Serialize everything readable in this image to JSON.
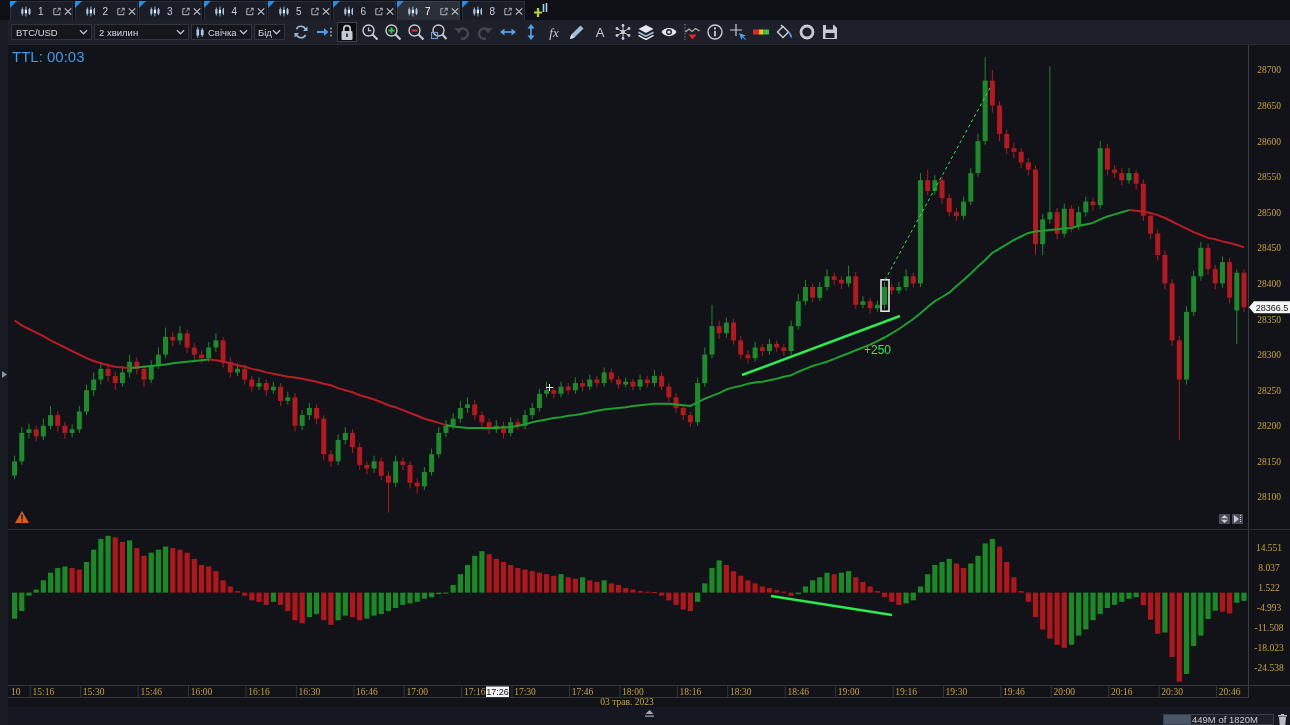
{
  "tabs": [
    {
      "label": "1",
      "selected": false
    },
    {
      "label": "2",
      "selected": false
    },
    {
      "label": "3",
      "selected": false
    },
    {
      "label": "4",
      "selected": false
    },
    {
      "label": "5",
      "selected": false
    },
    {
      "label": "6",
      "selected": false
    },
    {
      "label": "7",
      "selected": true
    },
    {
      "label": "8",
      "selected": false
    }
  ],
  "toolbar": {
    "selects": [
      {
        "kind": "symbol",
        "value": "BTC/USD"
      },
      {
        "kind": "timeframe",
        "value": "2 хвилин"
      },
      {
        "kind": "chart_type",
        "value": "Свічка"
      },
      {
        "kind": "price_side",
        "value": "Бід"
      }
    ],
    "tools": [
      {
        "kind": "refresh",
        "selected": false,
        "disabled": false
      },
      {
        "kind": "scroll_end",
        "selected": false,
        "disabled": false
      },
      {
        "kind": "lock",
        "selected": true,
        "disabled": false
      },
      {
        "kind": "zoom_time",
        "selected": false,
        "disabled": false
      },
      {
        "kind": "zoom_in",
        "selected": false,
        "disabled": false
      },
      {
        "kind": "zoom_out",
        "selected": false,
        "disabled": false
      },
      {
        "kind": "zoom_fit",
        "selected": false,
        "disabled": false
      },
      {
        "kind": "undo",
        "selected": false,
        "disabled": true
      },
      {
        "kind": "redo",
        "selected": false,
        "disabled": true
      },
      {
        "kind": "pan_horizontal",
        "selected": false,
        "disabled": false
      },
      {
        "kind": "pan_vertical",
        "selected": false,
        "disabled": false
      },
      {
        "kind": "function",
        "label": "fx",
        "selected": false,
        "disabled": false
      },
      {
        "kind": "pencil",
        "selected": false,
        "disabled": false
      },
      {
        "kind": "text",
        "label": "A",
        "selected": false,
        "disabled": false
      },
      {
        "kind": "nodes",
        "selected": false,
        "disabled": false
      },
      {
        "kind": "layers",
        "selected": false,
        "disabled": false
      },
      {
        "kind": "eye",
        "selected": false,
        "disabled": false
      },
      {
        "kind": "indicator",
        "selected": false,
        "disabled": false
      },
      {
        "kind": "info",
        "selected": false,
        "disabled": false
      },
      {
        "kind": "crosshair",
        "selected": false,
        "disabled": false
      },
      {
        "kind": "color_bar",
        "selected": false,
        "disabled": false
      },
      {
        "kind": "bucket",
        "selected": false,
        "disabled": false
      },
      {
        "kind": "ring",
        "selected": false,
        "disabled": false
      },
      {
        "kind": "save",
        "selected": false,
        "disabled": false
      }
    ]
  },
  "price_pane": {
    "timer": "TTL: 00:03",
    "last_price_label": "28366.5"
  },
  "chart_data": [
    {
      "type": "candlestick",
      "tick_labels": "y",
      "ylim": [
        28055,
        28735
      ],
      "yticks": [
        28100,
        28150,
        28200,
        28250,
        28300,
        28350,
        28400,
        28450,
        28500,
        28550,
        28600,
        28650,
        28700
      ],
      "annotations": [
        "+250"
      ],
      "series": [
        {
          "type": "candlestick",
          "ohlc": [
            [
              28130,
              28158,
              28125,
              28150
            ],
            [
              28150,
              28198,
              28145,
              28190
            ],
            [
              28190,
              28203,
              28182,
              28195
            ],
            [
              28195,
              28200,
              28178,
              28185
            ],
            [
              28185,
              28210,
              28180,
              28200
            ],
            [
              28200,
              28228,
              28195,
              28215
            ],
            [
              28215,
              28220,
              28192,
              28200
            ],
            [
              28200,
              28205,
              28182,
              28190
            ],
            [
              28190,
              28202,
              28184,
              28195
            ],
            [
              28195,
              28228,
              28190,
              28220
            ],
            [
              28220,
              28258,
              28215,
              28250
            ],
            [
              28250,
              28275,
              28242,
              28265
            ],
            [
              28265,
              28290,
              28258,
              28280
            ],
            [
              28280,
              28288,
              28262,
              28270
            ],
            [
              28270,
              28276,
              28250,
              28260
            ],
            [
              28260,
              28284,
              28255,
              28275
            ],
            [
              28275,
              28300,
              28268,
              28290
            ],
            [
              28290,
              28296,
              28272,
              28280
            ],
            [
              28280,
              28285,
              28255,
              28265
            ],
            [
              28265,
              28292,
              28260,
              28285
            ],
            [
              28285,
              28310,
              28280,
              28300
            ],
            [
              28300,
              28338,
              28295,
              28325
            ],
            [
              28325,
              28332,
              28312,
              28320
            ],
            [
              28320,
              28340,
              28314,
              28330
            ],
            [
              28330,
              28335,
              28302,
              28310
            ],
            [
              28310,
              28316,
              28292,
              28300
            ],
            [
              28300,
              28306,
              28288,
              28295
            ],
            [
              28295,
              28318,
              28290,
              28310
            ],
            [
              28310,
              28330,
              28304,
              28320
            ],
            [
              28320,
              28325,
              28282,
              28290
            ],
            [
              28290,
              28296,
              28268,
              28275
            ],
            [
              28275,
              28288,
              28270,
              28280
            ],
            [
              28280,
              28286,
              28258,
              28265
            ],
            [
              28265,
              28270,
              28248,
              28255
            ],
            [
              28255,
              28268,
              28250,
              28260
            ],
            [
              28260,
              28265,
              28242,
              28250
            ],
            [
              28250,
              28262,
              28245,
              28255
            ],
            [
              28255,
              28260,
              28228,
              28235
            ],
            [
              28235,
              28248,
              28230,
              28240
            ],
            [
              28240,
              28246,
              28192,
              28200
            ],
            [
              28200,
              28222,
              28194,
              28215
            ],
            [
              28215,
              28232,
              28208,
              28225
            ],
            [
              28225,
              28230,
              28202,
              28210
            ],
            [
              28210,
              28215,
              28152,
              28160
            ],
            [
              28160,
              28166,
              28142,
              28150
            ],
            [
              28150,
              28188,
              28145,
              28180
            ],
            [
              28180,
              28198,
              28174,
              28190
            ],
            [
              28190,
              28195,
              28162,
              28170
            ],
            [
              28170,
              28176,
              28138,
              28145
            ],
            [
              28145,
              28150,
              28132,
              28140
            ],
            [
              28140,
              28158,
              28134,
              28150
            ],
            [
              28150,
              28156,
              28124,
              28130
            ],
            [
              28130,
              28136,
              28078,
              28120
            ],
            [
              28120,
              28158,
              28114,
              28150
            ],
            [
              28150,
              28156,
              28138,
              28145
            ],
            [
              28145,
              28150,
              28112,
              28120
            ],
            [
              28120,
              28126,
              28105,
              28115
            ],
            [
              28115,
              28142,
              28110,
              28135
            ],
            [
              28135,
              28168,
              28130,
              28160
            ],
            [
              28160,
              28198,
              28155,
              28190
            ],
            [
              28190,
              28208,
              28184,
              28200
            ],
            [
              28200,
              28218,
              28195,
              28210
            ],
            [
              28210,
              28235,
              28204,
              28225
            ],
            [
              28225,
              28240,
              28218,
              28230
            ],
            [
              28230,
              28236,
              28208,
              28215
            ],
            [
              28215,
              28220,
              28198,
              28205
            ],
            [
              28205,
              28210,
              28188,
              28195
            ],
            [
              28195,
              28208,
              28190,
              28200
            ],
            [
              28200,
              28206,
              28182,
              28190
            ],
            [
              28190,
              28212,
              28185,
              28205
            ],
            [
              28205,
              28210,
              28194,
              28200
            ],
            [
              28200,
              28222,
              28195,
              28215
            ],
            [
              28215,
              28232,
              28210,
              28225
            ],
            [
              28225,
              28252,
              28220,
              28245
            ],
            [
              28245,
              28262,
              28240,
              28250
            ],
            [
              28250,
              28255,
              28238,
              28245
            ],
            [
              28245,
              28262,
              28240,
              28255
            ],
            [
              28255,
              28260,
              28244,
              28250
            ],
            [
              28250,
              28268,
              28245,
              28260
            ],
            [
              28260,
              28265,
              28248,
              28255
            ],
            [
              28255,
              28272,
              28250,
              28265
            ],
            [
              28265,
              28270,
              28254,
              28260
            ],
            [
              28260,
              28282,
              28255,
              28275
            ],
            [
              28275,
              28280,
              28260,
              28265
            ],
            [
              28265,
              28270,
              28252,
              28258
            ],
            [
              28258,
              28268,
              28254,
              28262
            ],
            [
              28262,
              28266,
              28250,
              28255
            ],
            [
              28255,
              28272,
              28250,
              28265
            ],
            [
              28265,
              28270,
              28254,
              28260
            ],
            [
              28260,
              28278,
              28255,
              28270
            ],
            [
              28270,
              28275,
              28250,
              28255
            ],
            [
              28255,
              28260,
              28234,
              28240
            ],
            [
              28240,
              28246,
              28218,
              28225
            ],
            [
              28225,
              28230,
              28208,
              28215
            ],
            [
              28215,
              28220,
              28198,
              28205
            ],
            [
              28205,
              28268,
              28200,
              28260
            ],
            [
              28260,
              28310,
              28255,
              28300
            ],
            [
              28300,
              28370,
              28295,
              28340
            ],
            [
              28340,
              28348,
              28322,
              28330
            ],
            [
              28330,
              28352,
              28324,
              28345
            ],
            [
              28345,
              28350,
              28314,
              28320
            ],
            [
              28320,
              28326,
              28294,
              28300
            ],
            [
              28300,
              28306,
              28288,
              28295
            ],
            [
              28295,
              28318,
              28290,
              28310
            ],
            [
              28310,
              28315,
              28298,
              28305
            ],
            [
              28305,
              28322,
              28300,
              28315
            ],
            [
              28315,
              28320,
              28304,
              28310
            ],
            [
              28310,
              28315,
              28298,
              28305
            ],
            [
              28305,
              28348,
              28300,
              28340
            ],
            [
              28340,
              28385,
              28335,
              28375
            ],
            [
              28375,
              28405,
              28370,
              28395
            ],
            [
              28395,
              28400,
              28374,
              28380
            ],
            [
              28380,
              28402,
              28375,
              28395
            ],
            [
              28395,
              28420,
              28390,
              28410
            ],
            [
              28410,
              28415,
              28398,
              28405
            ],
            [
              28405,
              28410,
              28392,
              28400
            ],
            [
              28400,
              28425,
              28395,
              28410
            ],
            [
              28410,
              28416,
              28364,
              28370
            ],
            [
              28370,
              28382,
              28365,
              28375
            ],
            [
              28375,
              28380,
              28358,
              28365
            ],
            [
              28365,
              28376,
              28360,
              28370
            ],
            [
              28370,
              28402,
              28364,
              28395
            ],
            [
              28395,
              28400,
              28384,
              28390
            ],
            [
              28390,
              28402,
              28385,
              28395
            ],
            [
              28395,
              28420,
              28390,
              28410
            ],
            [
              28410,
              28415,
              28394,
              28400
            ],
            [
              28400,
              28555,
              28395,
              28545
            ],
            [
              28545,
              28560,
              28524,
              28530
            ],
            [
              28530,
              28552,
              28525,
              28545
            ],
            [
              28545,
              28550,
              28512,
              28520
            ],
            [
              28520,
              28526,
              28494,
              28500
            ],
            [
              28500,
              28506,
              28488,
              28495
            ],
            [
              28495,
              28522,
              28490,
              28515
            ],
            [
              28515,
              28562,
              28510,
              28555
            ],
            [
              28555,
              28610,
              28550,
              28600
            ],
            [
              28600,
              28718,
              28595,
              28685
            ],
            [
              28685,
              28700,
              28640,
              28650
            ],
            [
              28650,
              28656,
              28600,
              28610
            ],
            [
              28610,
              28616,
              28582,
              28590
            ],
            [
              28590,
              28598,
              28576,
              28585
            ],
            [
              28585,
              28590,
              28562,
              28570
            ],
            [
              28570,
              28576,
              28552,
              28560
            ],
            [
              28560,
              28566,
              28440,
              28455
            ],
            [
              28455,
              28498,
              28440,
              28490
            ],
            [
              28490,
              28705,
              28484,
              28500
            ],
            [
              28500,
              28506,
              28462,
              28470
            ],
            [
              28470,
              28512,
              28465,
              28505
            ],
            [
              28505,
              28510,
              28472,
              28480
            ],
            [
              28480,
              28508,
              28475,
              28500
            ],
            [
              28500,
              28522,
              28494,
              28515
            ],
            [
              28515,
              28520,
              28502,
              28510
            ],
            [
              28510,
              28600,
              28505,
              28590
            ],
            [
              28590,
              28596,
              28552,
              28560
            ],
            [
              28560,
              28566,
              28548,
              28555
            ],
            [
              28555,
              28562,
              28538,
              28545
            ],
            [
              28545,
              28562,
              28540,
              28555
            ],
            [
              28555,
              28560,
              28532,
              28540
            ],
            [
              28540,
              28546,
              28488,
              28495
            ],
            [
              28495,
              28500,
              28462,
              28470
            ],
            [
              28470,
              28476,
              28432,
              28440
            ],
            [
              28440,
              28446,
              28392,
              28400
            ],
            [
              28400,
              28406,
              28312,
              28320
            ],
            [
              28320,
              28326,
              28180,
              28265
            ],
            [
              28265,
              28368,
              28258,
              28360
            ],
            [
              28360,
              28418,
              28354,
              28410
            ],
            [
              28410,
              28458,
              28404,
              28450
            ],
            [
              28450,
              28456,
              28412,
              28420
            ],
            [
              28420,
              28426,
              28392,
              28400
            ],
            [
              28400,
              28438,
              28394,
              28430
            ],
            [
              28430,
              28436,
              28372,
              28380
            ],
            [
              28362,
              28420,
              28315,
              28415
            ],
            [
              28415,
              28420,
              28360,
              28366.5
            ]
          ]
        },
        {
          "type": "line",
          "color": "#b81d25",
          "values": [
            28348,
            28341,
            28336,
            28331,
            28326,
            28320,
            28315,
            28310,
            28305,
            28300,
            28295,
            28291,
            28288,
            28285,
            28283,
            28282,
            28281,
            28282,
            null,
            null,
            null,
            null,
            null,
            null,
            null,
            null,
            null,
            28293,
            28292,
            28290,
            28288,
            28285,
            28283,
            28280,
            28278,
            28275,
            28273,
            28271,
            28269,
            28268,
            28266,
            28264,
            28262,
            28259,
            28257,
            28253,
            28250,
            28247,
            28243,
            28240,
            28237,
            28233,
            28229,
            28226,
            28222,
            28218,
            28214,
            28210,
            28207,
            28204,
            28201,
            null,
            null,
            null,
            null,
            null,
            null,
            null,
            null,
            null,
            null,
            null,
            null,
            null,
            null,
            null,
            null,
            null,
            null,
            null,
            null,
            null,
            null,
            null,
            null,
            null,
            null,
            null,
            null,
            null,
            null,
            null,
            null,
            null,
            null,
            null,
            null,
            null,
            null,
            null,
            null,
            null,
            null,
            null,
            null,
            null,
            null,
            null,
            null,
            null,
            null,
            null,
            null,
            null,
            null,
            null,
            null,
            null,
            null,
            null,
            null,
            null,
            null,
            null,
            null,
            null,
            null,
            null,
            null,
            null,
            null,
            null,
            null,
            null,
            null,
            null,
            null,
            null,
            null,
            null,
            null,
            null,
            null,
            null,
            null,
            null,
            null,
            null,
            null,
            null,
            null,
            null,
            null,
            null,
            null,
            28503,
            28502,
            28501,
            28499,
            28496,
            28492,
            28487,
            28482,
            28477,
            28472,
            28468,
            28464,
            28462,
            28459,
            28457,
            28454,
            28451
          ]
        },
        {
          "type": "line",
          "color": "#1f9e31",
          "values": [
            null,
            null,
            null,
            null,
            null,
            null,
            null,
            null,
            null,
            null,
            null,
            null,
            null,
            null,
            null,
            null,
            28281,
            28282,
            28283,
            28284,
            28285,
            28286,
            28288,
            28289,
            28290,
            28291,
            28292,
            28293,
            null,
            null,
            null,
            null,
            null,
            null,
            null,
            null,
            null,
            null,
            null,
            null,
            null,
            null,
            null,
            null,
            null,
            null,
            null,
            null,
            null,
            null,
            null,
            null,
            null,
            null,
            null,
            null,
            null,
            null,
            null,
            null,
            28201,
            28199,
            28198,
            28197,
            28197,
            28197,
            28197,
            28197,
            28198,
            28198,
            28200,
            28202,
            28205,
            28207,
            28209,
            28211,
            28212,
            28214,
            28215,
            28217,
            28219,
            28221,
            28223,
            28224,
            28225,
            28226,
            28228,
            28229,
            28230,
            28231,
            28231,
            28231,
            28230,
            28229,
            28228,
            28233,
            28238,
            28242,
            28246,
            28251,
            28254,
            28256,
            28259,
            28261,
            28262,
            28264,
            28266,
            28269,
            28271,
            28276,
            28280,
            28284,
            28287,
            28290,
            28294,
            28298,
            28302,
            28306,
            28310,
            28314,
            28319,
            28324,
            28330,
            28336,
            28343,
            28350,
            28358,
            28367,
            28375,
            28381,
            28387,
            28396,
            28405,
            28414,
            28424,
            28433,
            28443,
            28449,
            28455,
            28461,
            28466,
            28471,
            28473,
            28474,
            28475,
            28476,
            28477,
            28478,
            28481,
            28483,
            28485,
            28490,
            28494,
            28497,
            28500,
            28503,
            null,
            null,
            null,
            null,
            null,
            null,
            null,
            null,
            null,
            null,
            null,
            null,
            null,
            null,
            null,
            null
          ]
        }
      ]
    },
    {
      "type": "bar",
      "ylim": [
        -30.1,
        20.4
      ],
      "yticks": [
        14.551,
        8.037,
        1.522,
        -4.993,
        -11.508,
        -18.023,
        -24.538
      ],
      "categories": [
        null,
        null,
        null,
        null,
        "15:16",
        null,
        null,
        null,
        null,
        null,
        null,
        "15:30",
        null,
        null,
        null,
        null,
        null,
        null,
        null,
        "15:46",
        null,
        null,
        null,
        null,
        null,
        null,
        "16:00",
        null,
        null,
        null,
        null,
        null,
        null,
        null,
        "16:16",
        null,
        null,
        null,
        null,
        null,
        null,
        "16:30",
        null,
        null,
        null,
        null,
        null,
        null,
        null,
        "16:46",
        null,
        null,
        null,
        null,
        null,
        null,
        "17:00",
        null,
        null,
        null,
        null,
        null,
        null,
        null,
        "17:16",
        null,
        null,
        null,
        null,
        null,
        null,
        "17:30",
        null,
        null,
        null,
        null,
        null,
        null,
        null,
        "17:46",
        null,
        null,
        null,
        null,
        null,
        null,
        "18:00",
        null,
        null,
        null,
        null,
        null,
        null,
        null,
        "18:16",
        null,
        null,
        null,
        null,
        null,
        null,
        "18:30",
        null,
        null,
        null,
        null,
        null,
        null,
        null,
        "18:46",
        null,
        null,
        null,
        null,
        null,
        null,
        "19:00",
        null,
        null,
        null,
        null,
        null,
        null,
        null,
        "19:16",
        null,
        null,
        null,
        null,
        null,
        null,
        "19:30",
        null,
        null,
        null,
        null,
        null,
        null,
        null,
        "19:46",
        null,
        null,
        null,
        null,
        null,
        null,
        "20:00",
        null,
        null,
        null,
        null,
        null,
        null,
        null,
        "20:16",
        null,
        null,
        null,
        null,
        null,
        null,
        "20:30",
        null,
        null,
        null,
        null,
        null,
        null,
        null,
        "20:46",
        null,
        null
      ],
      "values": [
        -8.5,
        -6,
        -1,
        1,
        4,
        6.5,
        8,
        8.5,
        8,
        7.5,
        10,
        14,
        17.5,
        18.5,
        18,
        16.5,
        17,
        14.5,
        12,
        13,
        14,
        15,
        14.5,
        14,
        13,
        11,
        9,
        8.5,
        7,
        4,
        2,
        0.5,
        -1,
        -2.5,
        -3,
        -4,
        -3,
        -4,
        -6,
        -9,
        -10,
        -8,
        -7,
        -9,
        -10.5,
        -9,
        -7.5,
        -8,
        -9,
        -8.5,
        -7.5,
        -7,
        -6,
        -5,
        -4,
        -3.5,
        -3,
        -2,
        -1.5,
        -0.5,
        -0.2,
        2.5,
        6,
        9,
        12,
        13.5,
        12.5,
        11,
        10,
        9,
        8,
        7.5,
        7,
        6.5,
        6,
        5.5,
        6,
        5,
        4.5,
        5,
        4,
        3.5,
        4,
        3,
        2.5,
        1.5,
        1,
        0.5,
        0.3,
        0.2,
        -1,
        -2.5,
        -4,
        -5.5,
        -6,
        -3,
        3,
        8,
        10.5,
        9,
        7,
        5.5,
        4,
        3,
        2,
        1.5,
        0.8,
        0.3,
        -1,
        -0.5,
        2,
        4,
        5,
        6.5,
        6,
        6.5,
        7,
        5,
        3.5,
        2,
        0.5,
        -1.5,
        -3,
        -4,
        -3.5,
        -2.5,
        2,
        6,
        9,
        10,
        11,
        9.5,
        8,
        9.5,
        12,
        16,
        17.5,
        15,
        10,
        5,
        0.5,
        -3,
        -8,
        -12,
        -15,
        -17,
        -18,
        -17,
        -14,
        -12,
        -9,
        -7,
        -5,
        -4,
        -3,
        -2,
        -1.5,
        -4.1,
        -8.8,
        -13.4,
        -13,
        -21,
        -29,
        -26.5,
        -17.4,
        -14,
        -8.6,
        -5.9,
        -6.2,
        -6.8,
        -3.3,
        -2.7
      ],
      "colors": [
        "#1a8a26",
        "#1a8a26",
        "#1a8a26",
        "#1a8a26",
        "#1a8a26",
        "#1a8a26",
        "#1a8a26",
        "#1a8a26",
        "#b0171c",
        "#b0171c",
        "#1a8a26",
        "#1a8a26",
        "#1a8a26",
        "#1a8a26",
        "#b0171c",
        "#b0171c",
        "#1a8a26",
        "#b0171c",
        "#b0171c",
        "#1a8a26",
        "#1a8a26",
        "#1a8a26",
        "#b0171c",
        "#b0171c",
        "#b0171c",
        "#b0171c",
        "#b0171c",
        "#b0171c",
        "#b0171c",
        "#b0171c",
        "#b0171c",
        "#b0171c",
        "#b0171c",
        "#b0171c",
        "#b0171c",
        "#b0171c",
        "#1a8a26",
        "#b0171c",
        "#b0171c",
        "#b0171c",
        "#b0171c",
        "#1a8a26",
        "#1a8a26",
        "#b0171c",
        "#b0171c",
        "#1a8a26",
        "#1a8a26",
        "#b0171c",
        "#b0171c",
        "#1a8a26",
        "#1a8a26",
        "#1a8a26",
        "#1a8a26",
        "#1a8a26",
        "#1a8a26",
        "#1a8a26",
        "#1a8a26",
        "#1a8a26",
        "#1a8a26",
        "#1a8a26",
        "#1a8a26",
        "#1a8a26",
        "#1a8a26",
        "#1a8a26",
        "#1a8a26",
        "#1a8a26",
        "#b0171c",
        "#b0171c",
        "#b0171c",
        "#b0171c",
        "#b0171c",
        "#b0171c",
        "#b0171c",
        "#b0171c",
        "#b0171c",
        "#b0171c",
        "#1a8a26",
        "#b0171c",
        "#b0171c",
        "#1a8a26",
        "#b0171c",
        "#b0171c",
        "#1a8a26",
        "#b0171c",
        "#b0171c",
        "#b0171c",
        "#b0171c",
        "#b0171c",
        "#b0171c",
        "#b0171c",
        "#b0171c",
        "#b0171c",
        "#b0171c",
        "#b0171c",
        "#b0171c",
        "#1a8a26",
        "#1a8a26",
        "#1a8a26",
        "#1a8a26",
        "#b0171c",
        "#b0171c",
        "#b0171c",
        "#b0171c",
        "#b0171c",
        "#b0171c",
        "#b0171c",
        "#b0171c",
        "#b0171c",
        "#b0171c",
        "#1a8a26",
        "#1a8a26",
        "#1a8a26",
        "#1a8a26",
        "#1a8a26",
        "#b0171c",
        "#1a8a26",
        "#1a8a26",
        "#b0171c",
        "#b0171c",
        "#b0171c",
        "#b0171c",
        "#b0171c",
        "#b0171c",
        "#b0171c",
        "#1a8a26",
        "#1a8a26",
        "#1a8a26",
        "#1a8a26",
        "#1a8a26",
        "#1a8a26",
        "#1a8a26",
        "#b0171c",
        "#b0171c",
        "#1a8a26",
        "#1a8a26",
        "#1a8a26",
        "#1a8a26",
        "#b0171c",
        "#b0171c",
        "#b0171c",
        "#b0171c",
        "#b0171c",
        "#b0171c",
        "#b0171c",
        "#b0171c",
        "#b0171c",
        "#b0171c",
        "#1a8a26",
        "#1a8a26",
        "#1a8a26",
        "#1a8a26",
        "#1a8a26",
        "#1a8a26",
        "#1a8a26",
        "#1a8a26",
        "#1a8a26",
        "#1a8a26",
        "#b0171c",
        "#b0171c",
        "#b0171c",
        "#1a8a26",
        "#b0171c",
        "#b0171c",
        "#1a8a26",
        "#1a8a26",
        "#1a8a26",
        "#1a8a26",
        "#1a8a26",
        "#b0171c",
        "#b0171c",
        "#1a8a26",
        "#1a8a26"
      ]
    }
  ],
  "time_axis": {
    "edge_label": "10",
    "cursor_time": "17:26",
    "date": "03 трав. 2023"
  },
  "status_bar": {
    "memory_meter": {
      "label": "449M of 1820M",
      "level": 0.247
    }
  }
}
